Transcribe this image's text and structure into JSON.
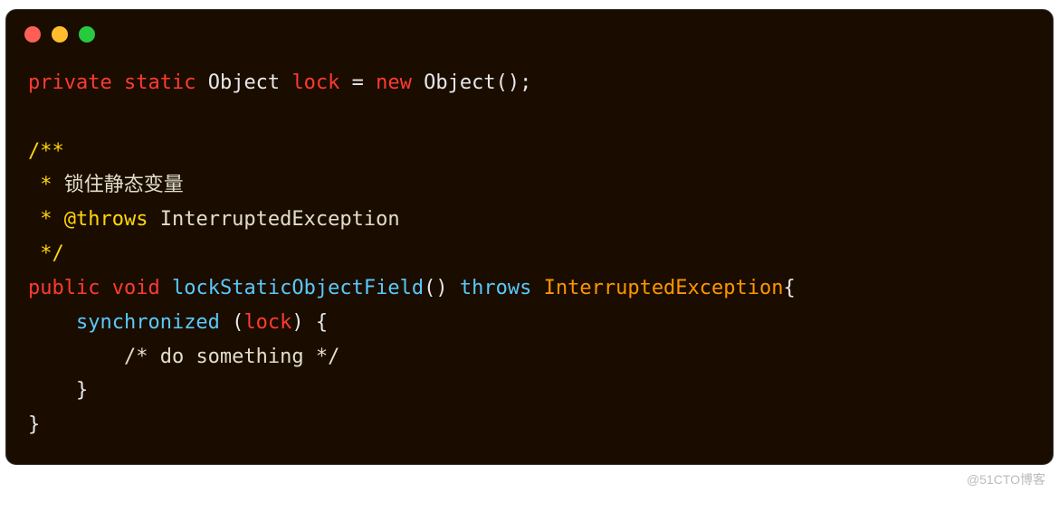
{
  "code": {
    "line1": {
      "private": "private",
      "static": "static",
      "object": "Object",
      "lock": "lock",
      "eq": " = ",
      "new": "new",
      "object2": "Object",
      "parens": "();"
    },
    "empty1": "",
    "doc_start": "/**",
    "doc_line1_prefix": " * ",
    "doc_line1_text": "锁住静态变量",
    "doc_line2_prefix": " * ",
    "doc_at_throws": "@throws",
    "doc_exception": " InterruptedException",
    "doc_end": " */",
    "line2": {
      "public": "public",
      "void": "void",
      "method": "lockStaticObjectField",
      "parens": "()",
      "throws": "throws",
      "exception": "InterruptedException",
      "brace": "{"
    },
    "line3": {
      "indent": "    ",
      "sync": "synchronized",
      "open": " (",
      "lock": "lock",
      "close": ") {"
    },
    "line4_indent": "        ",
    "line4_comment": "/* do something */",
    "line5": "    }",
    "line6": "}"
  },
  "watermark": "@51CTO博客"
}
